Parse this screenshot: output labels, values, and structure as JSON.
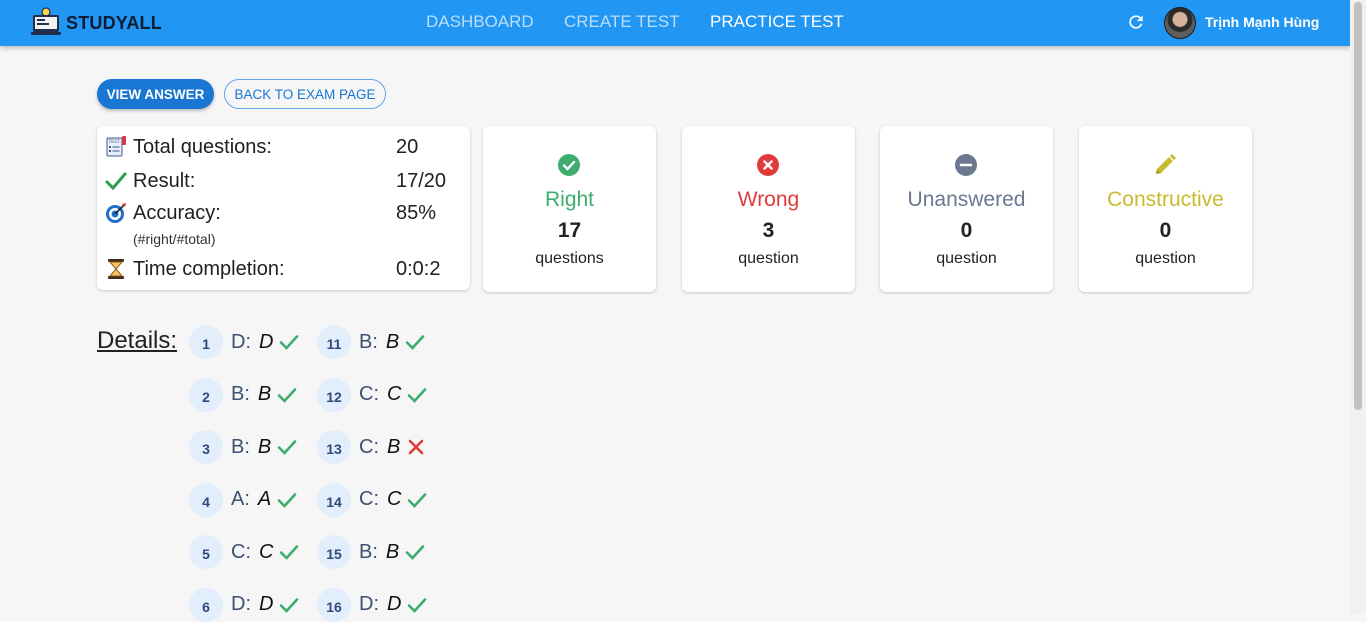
{
  "app": {
    "brand": "STUDYALL",
    "user_name": "Trịnh Mạnh Hùng"
  },
  "nav": [
    {
      "label": "DASHBOARD",
      "active": false
    },
    {
      "label": "CREATE TEST",
      "active": false
    },
    {
      "label": "PRACTICE TEST",
      "active": true
    }
  ],
  "actions": {
    "view_answer": "VIEW ANSWER",
    "back": "BACK TO EXAM PAGE"
  },
  "summary": {
    "total_label": "Total questions:",
    "total_value": "20",
    "result_label": "Result:",
    "result_value": "17/20",
    "accuracy_label": "Accuracy:",
    "accuracy_value": "85%",
    "accuracy_note": "(#right/#total)",
    "time_label": "Time completion:",
    "time_value": "0:0:2"
  },
  "stats": [
    {
      "title": "Right",
      "count": "17",
      "unit": "questions",
      "color": "#3cad6e",
      "icon": "check-circle-icon"
    },
    {
      "title": "Wrong",
      "count": "3",
      "unit": "question",
      "color": "#e03b3b",
      "icon": "x-circle-icon"
    },
    {
      "title": "Unanswered",
      "count": "0",
      "unit": "question",
      "color": "#6b7890",
      "icon": "minus-circle-icon"
    },
    {
      "title": "Constructive",
      "count": "0",
      "unit": "question",
      "color": "#c8bb2e",
      "icon": "pencil-icon"
    }
  ],
  "details": {
    "label": "Details:",
    "items": [
      {
        "num": "1",
        "key": "D",
        "answer": "D",
        "correct": true
      },
      {
        "num": "2",
        "key": "B",
        "answer": "B",
        "correct": true
      },
      {
        "num": "3",
        "key": "B",
        "answer": "B",
        "correct": true
      },
      {
        "num": "4",
        "key": "A",
        "answer": "A",
        "correct": true
      },
      {
        "num": "5",
        "key": "C",
        "answer": "C",
        "correct": true
      },
      {
        "num": "6",
        "key": "D",
        "answer": "D",
        "correct": true
      },
      {
        "num": "11",
        "key": "B",
        "answer": "B",
        "correct": true
      },
      {
        "num": "12",
        "key": "C",
        "answer": "C",
        "correct": true
      },
      {
        "num": "13",
        "key": "C",
        "answer": "B",
        "correct": false
      },
      {
        "num": "14",
        "key": "C",
        "answer": "C",
        "correct": true
      },
      {
        "num": "15",
        "key": "B",
        "answer": "B",
        "correct": true
      },
      {
        "num": "16",
        "key": "D",
        "answer": "D",
        "correct": true
      }
    ]
  },
  "colors": {
    "navbar": "#2196f3",
    "primary": "#1976d2",
    "right": "#3cad6e",
    "wrong": "#e03b3b"
  }
}
